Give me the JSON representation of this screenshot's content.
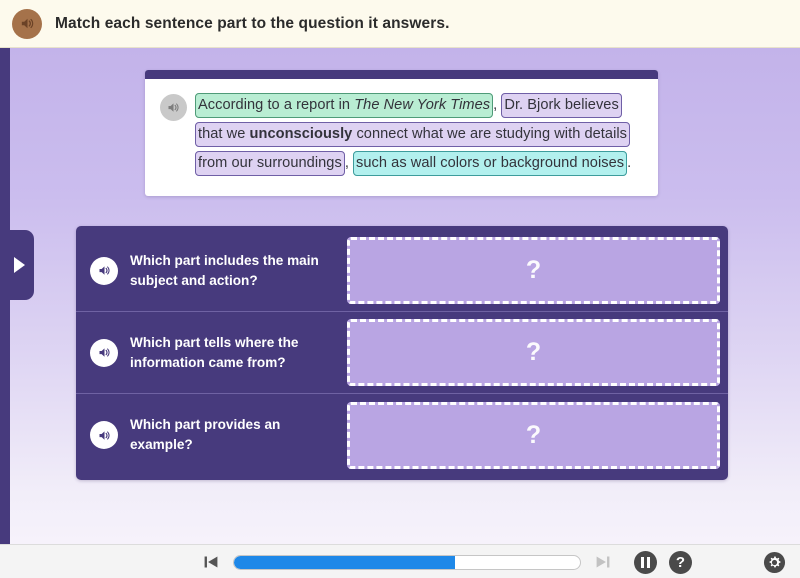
{
  "header": {
    "speaker_icon": "speaker-icon",
    "instruction": "Match each sentence part to the question it answers."
  },
  "sentence_card": {
    "speaker_icon": "speaker-icon",
    "segments": [
      {
        "id": "segment-source",
        "color": "#b9edd3",
        "border": "#4f9b78",
        "text_before_italic": "According to a report in ",
        "italic_text": "The New York Times",
        "text_after_italic": ""
      },
      {
        "id": "segment-subject-action",
        "color": "#ded2f2",
        "border": "#6f5fa6",
        "text_before_bold": "Dr. Bjork believes that we ",
        "bold_text": "unconsciously",
        "text_after_bold": " connect what we are studying with details from our surroundings"
      },
      {
        "id": "segment-example",
        "color": "#b2f0ee",
        "border": "#3d9c9c",
        "text": "such as wall colors or background noises"
      }
    ],
    "separator_1": ",",
    "separator_2": ",",
    "terminator": "."
  },
  "match_rows": [
    {
      "speaker_icon": "speaker-icon",
      "question": "Which part includes the main subject and action?",
      "dropzone_placeholder": "?"
    },
    {
      "speaker_icon": "speaker-icon",
      "question": "Which part tells where the information came from?",
      "dropzone_placeholder": "?"
    },
    {
      "speaker_icon": "speaker-icon",
      "question": "Which part provides an example?",
      "dropzone_placeholder": "?"
    }
  ],
  "side_tab": {
    "icon": "triangle-right-icon"
  },
  "toolbar": {
    "prev_icon": "skip-previous-icon",
    "next_icon": "skip-next-icon",
    "pause_icon": "pause-icon",
    "help_icon": "help-icon",
    "gear_icon": "gear-icon",
    "help_label": "?",
    "progress_percent": 64,
    "progress_fill_color": "#1e88e8"
  }
}
